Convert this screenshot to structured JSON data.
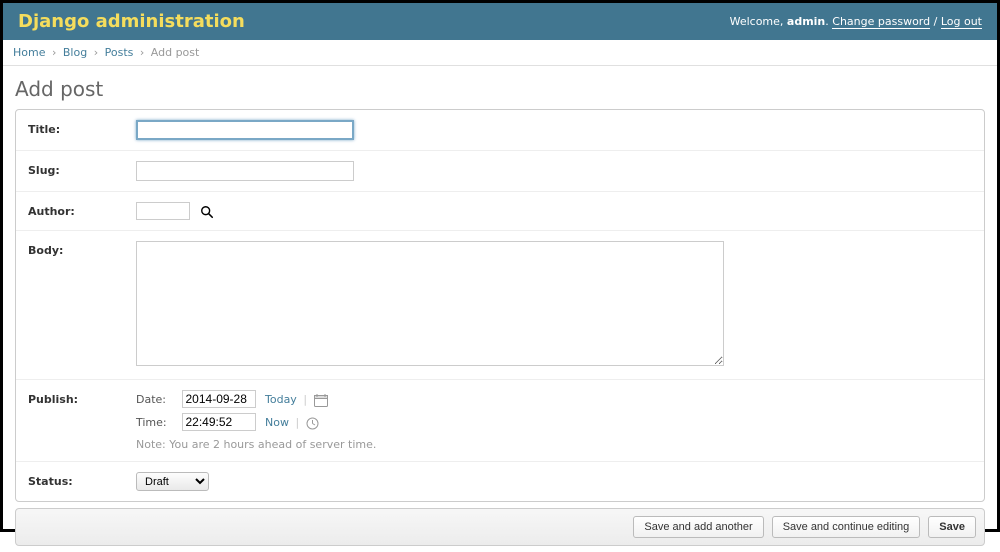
{
  "header": {
    "branding": "Django administration",
    "welcome_prefix": "Welcome, ",
    "username": "admin",
    "change_password": "Change password",
    "logout": "Log out"
  },
  "breadcrumbs": {
    "home": "Home",
    "app": "Blog",
    "model": "Posts",
    "current": "Add post"
  },
  "page_title": "Add post",
  "fields": {
    "title_label": "Title:",
    "title_value": "",
    "slug_label": "Slug:",
    "slug_value": "",
    "author_label": "Author:",
    "author_value": "",
    "body_label": "Body:",
    "body_value": "",
    "publish_label": "Publish:",
    "publish_date_sublabel": "Date:",
    "publish_date_value": "2014-09-28",
    "publish_today": "Today",
    "publish_time_sublabel": "Time:",
    "publish_time_value": "22:49:52",
    "publish_now": "Now",
    "timezone_note": "Note: You are 2 hours ahead of server time.",
    "status_label": "Status:",
    "status_selected": "Draft"
  },
  "buttons": {
    "save_add_another": "Save and add another",
    "save_continue": "Save and continue editing",
    "save": "Save"
  }
}
